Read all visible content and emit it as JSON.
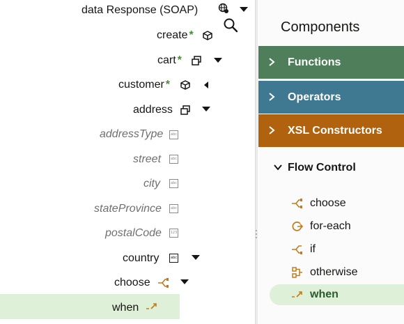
{
  "tree": {
    "root_label": "data Response (SOAP)",
    "items": [
      {
        "label": "create",
        "required": "*"
      },
      {
        "label": "cart",
        "required": "*"
      },
      {
        "label": "customer",
        "required": "*"
      },
      {
        "label": "address"
      },
      {
        "label": "addressType",
        "type_badge": "abc"
      },
      {
        "label": "street",
        "type_badge": "abc"
      },
      {
        "label": "city",
        "type_badge": "abc"
      },
      {
        "label": "stateProvince",
        "type_badge": "abc"
      },
      {
        "label": "postalCode",
        "type_badge": "123"
      },
      {
        "label": "country",
        "type_badge": "abc"
      },
      {
        "label": "choose"
      },
      {
        "label": "when"
      }
    ]
  },
  "components": {
    "title": "Components",
    "sections": [
      {
        "label": "Functions",
        "color": "#4f7e5b"
      },
      {
        "label": "Operators",
        "color": "#3f7891"
      },
      {
        "label": "XSL Constructors",
        "color": "#b0620e"
      }
    ],
    "flow_control": {
      "label": "Flow Control",
      "items": [
        {
          "label": "choose",
          "icon": "choose-icon"
        },
        {
          "label": "for-each",
          "icon": "for-each-icon"
        },
        {
          "label": "if",
          "icon": "if-icon"
        },
        {
          "label": "otherwise",
          "icon": "otherwise-icon"
        },
        {
          "label": "when",
          "icon": "when-icon",
          "selected": true
        }
      ]
    }
  },
  "colors": {
    "accent_orange": "#c47a1a",
    "selection_green": "#dff0d8",
    "required_green": "#4a8a3a"
  }
}
